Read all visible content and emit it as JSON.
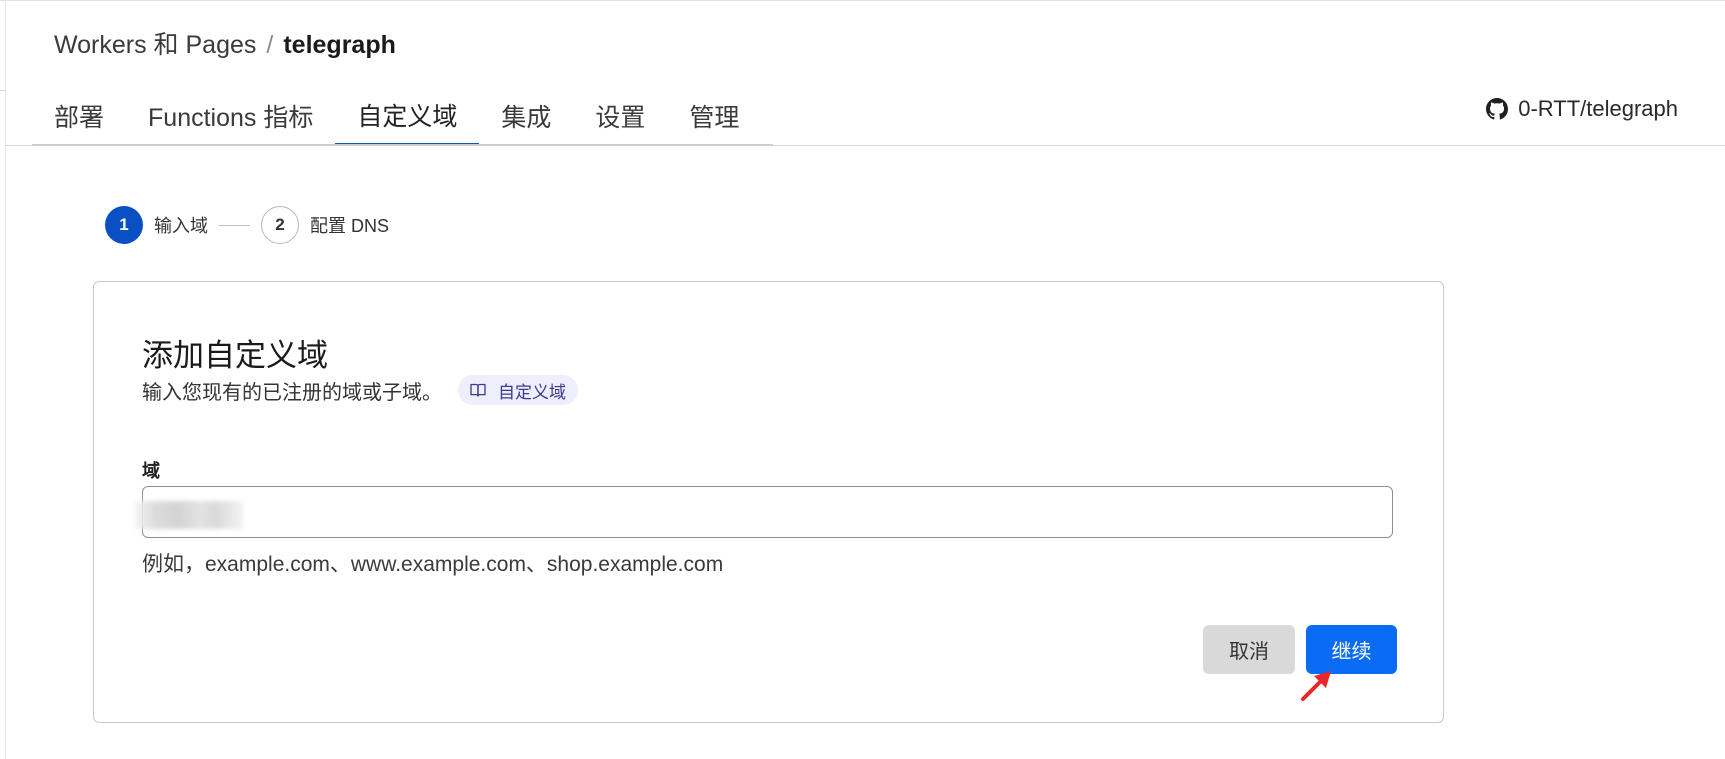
{
  "breadcrumb": {
    "parent": "Workers 和 Pages",
    "separator": "/",
    "current": "telegraph"
  },
  "tabs": [
    {
      "label": "部署",
      "active": false
    },
    {
      "label": "Functions 指标",
      "active": false
    },
    {
      "label": "自定义域",
      "active": true
    },
    {
      "label": "集成",
      "active": false
    },
    {
      "label": "设置",
      "active": false
    },
    {
      "label": "管理",
      "active": false
    }
  ],
  "repo": {
    "icon": "github-icon",
    "label": "0-RTT/telegraph"
  },
  "stepper": {
    "steps": [
      {
        "number": "1",
        "label": "输入域",
        "state": "current"
      },
      {
        "number": "2",
        "label": "配置 DNS",
        "state": "pending"
      }
    ]
  },
  "card": {
    "title": "添加自定义域",
    "description": "输入您现有的已注册的域或子域。",
    "doc_link": {
      "icon": "book-icon",
      "label": "自定义域"
    },
    "field_label": "域",
    "input_value": "",
    "hint": "例如，example.com、www.example.com、shop.example.com",
    "cancel_label": "取消",
    "continue_label": "继续"
  },
  "colors": {
    "accent": "#0a6cf5",
    "step_active": "#0a4fc4",
    "tab_indicator": "#1453b8",
    "annotation_arrow": "#e8262b"
  }
}
